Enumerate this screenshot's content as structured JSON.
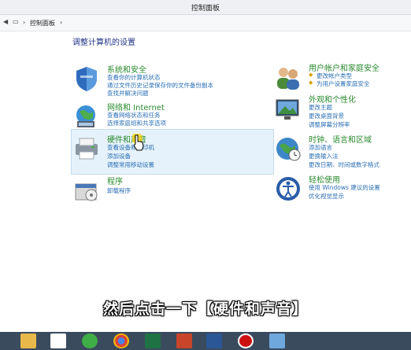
{
  "window": {
    "title": "控制面板"
  },
  "address": {
    "crumb": "控制面板"
  },
  "main": {
    "heading": "调整计算机的设置",
    "categories": [
      {
        "title": "系统和安全",
        "links": [
          "查看你的计算机状态",
          "通过文件历史记录保存你的文件备份副本",
          "查找并解决问题"
        ]
      },
      {
        "title": "网络和 Internet",
        "links": [
          "查看网络状态和任务",
          "选择家庭组和共享选项"
        ]
      },
      {
        "title": "硬件和声音",
        "links": [
          "查看设备和打印机",
          "添加设备",
          "调整常用移动设置"
        ]
      },
      {
        "title": "程序",
        "links": [
          "卸载程序"
        ]
      },
      {
        "title": "用户帐户和家庭安全",
        "links": [
          "更改帐户类型",
          "为用户设置家庭安全"
        ]
      },
      {
        "title": "外观和个性化",
        "links": [
          "更改主题",
          "更改桌面背景",
          "调整屏幕分辨率"
        ]
      },
      {
        "title": "时钟、语言和区域",
        "links": [
          "添加语言",
          "更换输入法",
          "更改日期、时间或数字格式"
        ]
      },
      {
        "title": "轻松使用",
        "links": [
          "使用 Windows 建议的设置",
          "优化视觉显示"
        ]
      }
    ]
  },
  "overlay": {
    "caption": "然后点击一下【硬件和声音】"
  },
  "colors": {
    "title_green": "#2a8a2e",
    "link_blue": "#2a6fb4",
    "heading_blue": "#1e3287",
    "taskbar": "#3a4b5e"
  },
  "taskbar": {
    "icons": [
      "windows-explorer-icon",
      "baidu-cloud-icon",
      "360-browser-icon",
      "chrome-icon",
      "excel-icon",
      "powerpoint-icon",
      "word-icon",
      "record-icon",
      "screenshot-tool-icon"
    ]
  }
}
